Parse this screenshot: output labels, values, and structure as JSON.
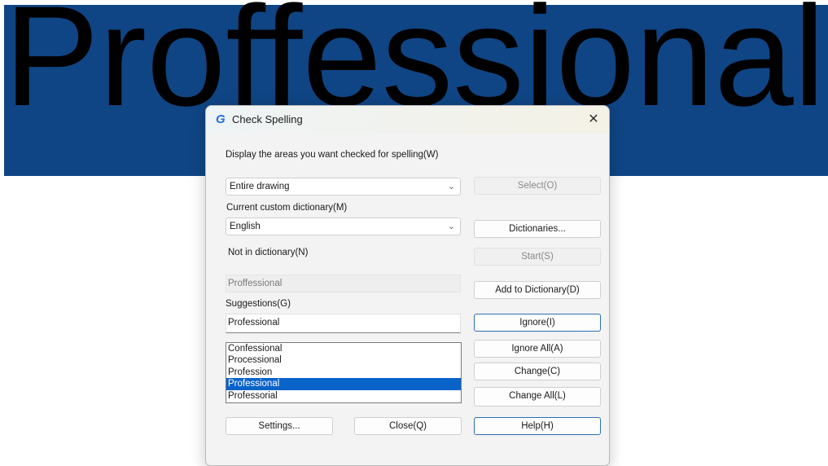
{
  "canvas": {
    "drawing_text": "Proffessional",
    "background_color": "#0f4584"
  },
  "dialog": {
    "title": "Check Spelling",
    "app_icon": "gstarcad-g-icon",
    "close_icon": "close-icon",
    "areas_label": "Display the areas you want checked for spelling(W)",
    "areas_value": "Entire drawing",
    "select_button": "Select(O)",
    "dictionary_label": "Current custom dictionary(M)",
    "dictionary_value": "English",
    "dictionaries_button": "Dictionaries...",
    "not_in_dictionary_label": "Not in dictionary(N)",
    "start_button": "Start(S)",
    "not_in_dictionary_value": "Proffessional",
    "add_to_dictionary_button": "Add to Dictionary(D)",
    "suggestions_label": "Suggestions(G)",
    "suggestion_value": "Professional",
    "ignore_button": "Ignore(I)",
    "ignore_all_button": "Ignore All(A)",
    "change_button": "Change(C)",
    "change_all_button": "Change All(L)",
    "suggestions_list": [
      "Confessional",
      "Processional",
      "Profession",
      "Professional",
      "Professorial"
    ],
    "selected_suggestion": "Professional",
    "settings_button": "Settings...",
    "close_button": "Close(Q)",
    "help_button": "Help(H)"
  }
}
